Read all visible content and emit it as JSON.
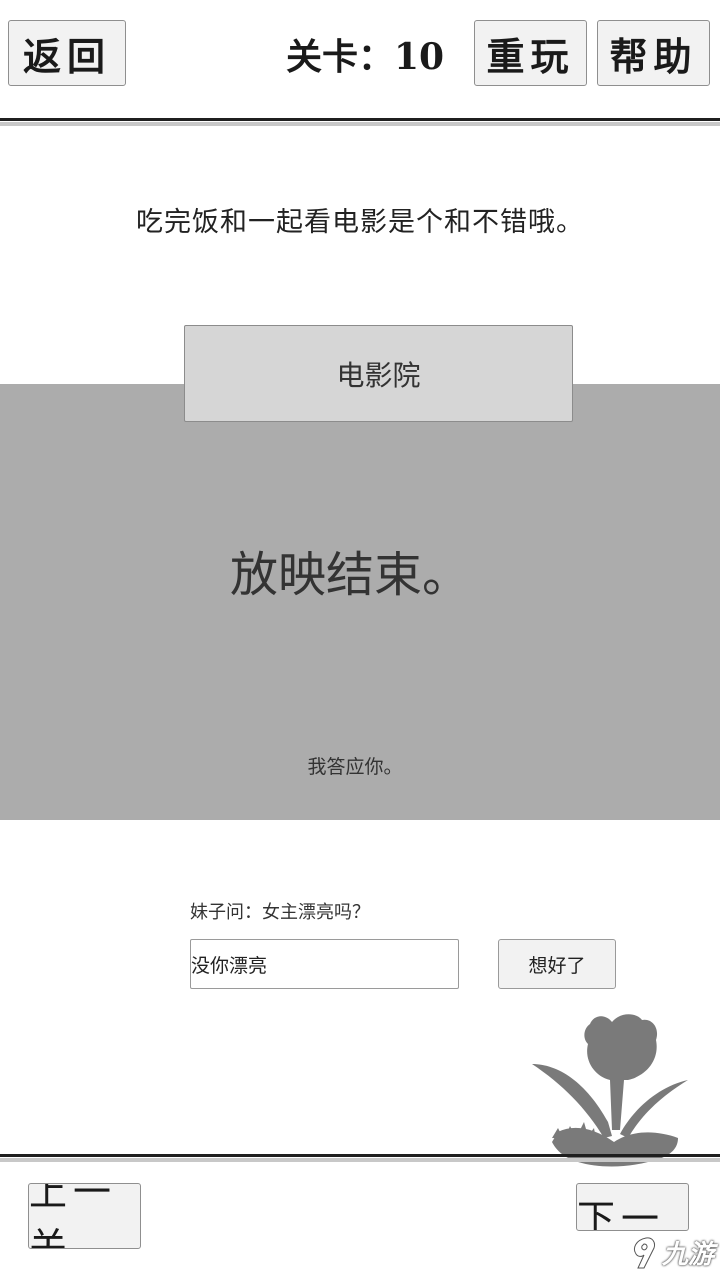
{
  "header": {
    "back_label": "返回",
    "level_label": "关卡：10",
    "replay_label": "重玩",
    "help_label": "帮助"
  },
  "puzzle": {
    "sentence": "吃完饭和一起看电影是个和不错哦。"
  },
  "scene": {
    "location_button": "电影院",
    "main_text": "放映结束。",
    "sub_text": "我答应你。"
  },
  "answer": {
    "question": "妹子问：女主漂亮吗？",
    "input_value": "没你漂亮",
    "confirm_label": "想好了"
  },
  "footer": {
    "prev_label": "上一关",
    "next_label": "下一关"
  },
  "decoration": {
    "plant_icon": "tulip-icon",
    "watermark_icon": "9you-logo-icon",
    "watermark_text": "九游"
  },
  "colors": {
    "scene_panel": "#acacac",
    "scene_button": "#d6d6d6",
    "button_bg": "#f2f2f2",
    "rule": "#1f1f1f"
  }
}
